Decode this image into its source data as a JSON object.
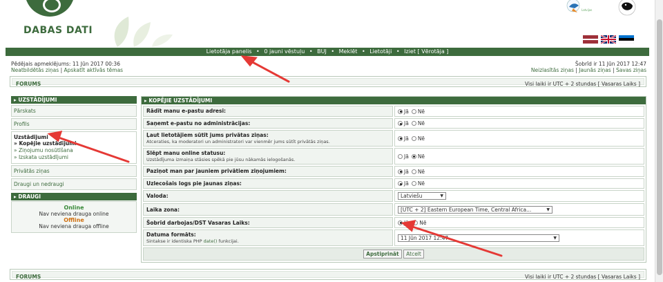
{
  "header": {
    "logo_text": "DABAS DATI",
    "flags": [
      "latvian-flag",
      "uk-flag",
      "estonian-flag"
    ]
  },
  "navbar": {
    "items": [
      "Lietotāja panelis",
      "0 jauni vēstuļu",
      "BUJ",
      "Meklēt",
      "Lietotāji",
      "Iziet [ Vērotāja ]"
    ]
  },
  "info": {
    "last_visit": "Pēdējais apmeklējums: 11 Jūn 2017 00:36",
    "unanswered": "Neatbildētās ziņas",
    "active": "Apskatīt aktīvās tēmas",
    "now": "Šobrīd ir 11 Jūn 2017 12:47",
    "unread": "Neizlasītās ziņas",
    "new_posts": "Jaunās ziņas",
    "own_posts": "Savas ziņas"
  },
  "forums_bar": {
    "label": "FORUMS",
    "timezone": "Visi laiki ir UTC + 2 stundas [ Vasaras Laiks ]"
  },
  "sidebar": {
    "settings_title": "UZSTĀDĪJUMI",
    "overview": "Pārskats",
    "profile": "Profils",
    "settings_label": "Uzstādījumi",
    "sub_general": "» Kopējie uzstādījumi",
    "sub_notifications": "» Ziņojumu nosūtīšana",
    "sub_display": "» Izskata uzstādījumi",
    "private_messages": "Privātās ziņas",
    "friends_foes": "Draugi un nedraugi",
    "friends_title": "DRAUGI",
    "online_label": "Online",
    "online_empty": "Nav neviena drauga online",
    "offline_label": "Offline",
    "offline_empty": "Nav neviena drauga offline"
  },
  "main": {
    "title": "KOPĒJIE UZSTĀDĪJUMI",
    "yes": "Jā",
    "no": "Nē",
    "rows": [
      {
        "label": "Rādīt manu e-pastu adresi:",
        "hint": "",
        "value": "yes"
      },
      {
        "label": "Saņemt e-pastu no administrācijas:",
        "hint": "",
        "value": "yes"
      },
      {
        "label": "Ļaut lietotājiem sūtīt jums privātas ziņas:",
        "hint": "Atceraties, ka moderatori un administratori var vienmēr jums sūtīt privātās ziņas.",
        "value": "yes"
      },
      {
        "label": "Slēpt manu online statusu:",
        "hint": "Uzstādījuma izmaiņa stāsies spēkā pie jūsu nākamās ielogošanās.",
        "value": "no"
      },
      {
        "label": "Paziņot man par jauniem privātiem ziņojumiem:",
        "hint": "",
        "value": "yes"
      },
      {
        "label": "Uzlecošais logs pie jaunas ziņas:",
        "hint": "",
        "value": "yes"
      }
    ],
    "language_label": "Valoda:",
    "language_value": "Latviešu",
    "timezone_label": "Laika zona:",
    "timezone_value": "[UTC + 2] Eastern European Time, Central Africa...",
    "dst_label": "Šobrīd darbojas/DST Vasaras Laiks:",
    "dst_value": "yes",
    "date_label": "Datuma formāts:",
    "date_hint_pre": "Sintakse ir identiska PHP",
    "date_hint_link": "date()",
    "date_hint_post": "funkcijai.",
    "date_value": "11 Jūn 2017 12:47",
    "submit": "Apstiprināt",
    "reset": "Atcelt"
  },
  "colors": {
    "brand_green": "#3d6b3d",
    "annotation_red": "#e53935"
  }
}
